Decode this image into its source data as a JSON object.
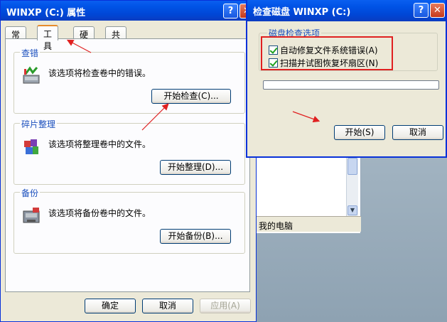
{
  "properties_window": {
    "title": "WINXP (C:) 属性",
    "help_glyph": "?",
    "close_glyph": "✕",
    "tabs": [
      {
        "label": "常规"
      },
      {
        "label": "工具"
      },
      {
        "label": "硬件"
      },
      {
        "label": "共享"
      }
    ],
    "active_tab": "工具",
    "groups": [
      {
        "title": "查错",
        "text": "该选项将检查卷中的错误。",
        "button": "开始检查(C)..."
      },
      {
        "title": "碎片整理",
        "text": "该选项将整理卷中的文件。",
        "button": "开始整理(D)..."
      },
      {
        "title": "备份",
        "text": "该选项将备份卷中的文件。",
        "button": "开始备份(B)..."
      }
    ],
    "footer": {
      "ok": "确定",
      "cancel": "取消",
      "apply": "应用(A)"
    }
  },
  "check_disk_dialog": {
    "title": "检查磁盘 WINXP (C:)",
    "help_glyph": "?",
    "close_glyph": "✕",
    "group_title": "磁盘检查选项",
    "options": [
      {
        "label": "自动修复文件系统错误(A)",
        "checked": true
      },
      {
        "label": "扫描并试图恢复坏扇区(N)",
        "checked": true
      }
    ],
    "progress": 0,
    "start_button": "开始(S)",
    "cancel_button": "取消"
  },
  "background_explorer": {
    "status_text": "我的电脑"
  },
  "colors": {
    "titlebar_blue": "#0053e6",
    "annotation_red": "#e02020",
    "group_title_blue": "#1b4fbd"
  }
}
